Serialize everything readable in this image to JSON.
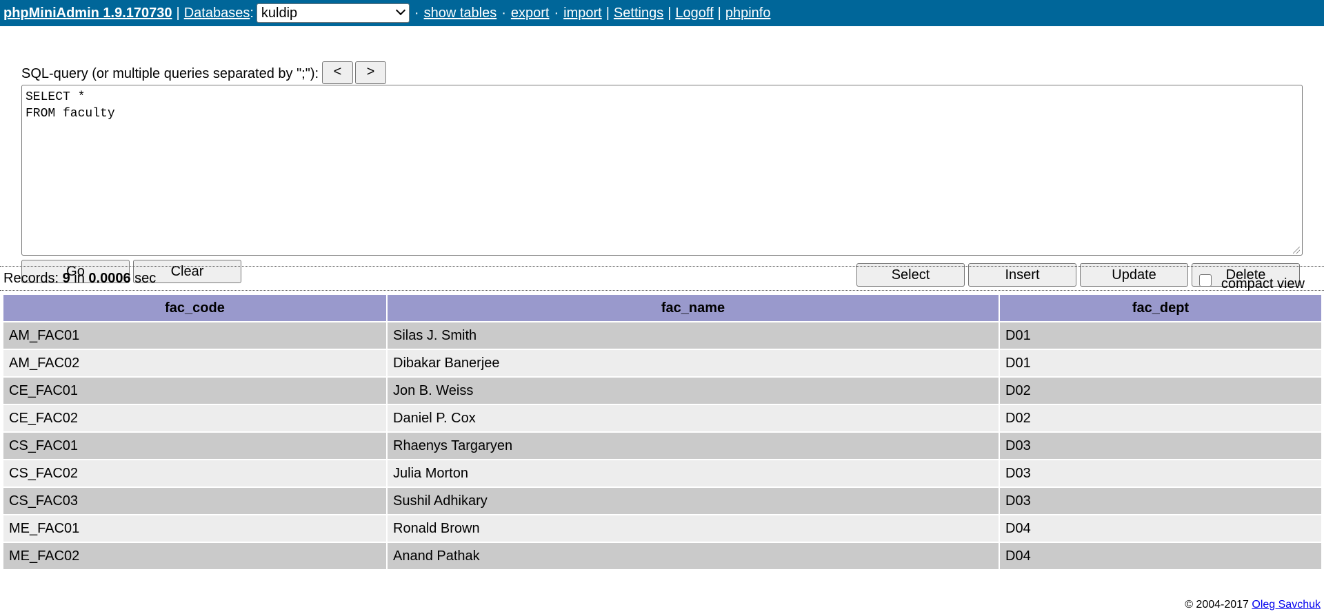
{
  "nav": {
    "brand": "phpMiniAdmin 1.9.170730",
    "databases_label": "Databases",
    "colon": ":",
    "selected_db": "kuldip",
    "show_tables": "show tables",
    "export": "export",
    "import": "import",
    "settings": "Settings",
    "logoff": "Logoff",
    "phpinfo": "phpinfo"
  },
  "query": {
    "label": "SQL-query (or multiple queries separated by \";\"):",
    "prev_label": "<",
    "next_label": ">",
    "sql": "SELECT *\nFROM faculty",
    "go_label": "Go",
    "clear_label": "Clear",
    "select_label": "Select",
    "insert_label": "Insert",
    "update_label": "Update",
    "delete_label": "Delete"
  },
  "status": {
    "records_label": "Records:",
    "count": "9",
    "in_label": "in",
    "time": "0.0006",
    "sec_label": "sec",
    "compact_view_label": "compact view",
    "compact_view_checked": false
  },
  "table": {
    "columns": [
      "fac_code",
      "fac_name",
      "fac_dept"
    ],
    "rows": [
      [
        "AM_FAC01",
        "Silas J. Smith",
        "D01"
      ],
      [
        "AM_FAC02",
        "Dibakar Banerjee",
        "D01"
      ],
      [
        "CE_FAC01",
        "Jon B. Weiss",
        "D02"
      ],
      [
        "CE_FAC02",
        "Daniel P. Cox",
        "D02"
      ],
      [
        "CS_FAC01",
        "Rhaenys Targaryen",
        "D03"
      ],
      [
        "CS_FAC02",
        "Julia Morton",
        "D03"
      ],
      [
        "CS_FAC03",
        "Sushil Adhikary",
        "D03"
      ],
      [
        "ME_FAC01",
        "Ronald Brown",
        "D04"
      ],
      [
        "ME_FAC02",
        "Anand Pathak",
        "D04"
      ]
    ]
  },
  "footer": {
    "copyright": "© 2004-2017",
    "author": "Oleg Savchuk"
  },
  "colors": {
    "topbar_bg": "#006699",
    "header_bg": "#9999cc",
    "row_dark": "#cacaca",
    "row_light": "#ededed"
  }
}
